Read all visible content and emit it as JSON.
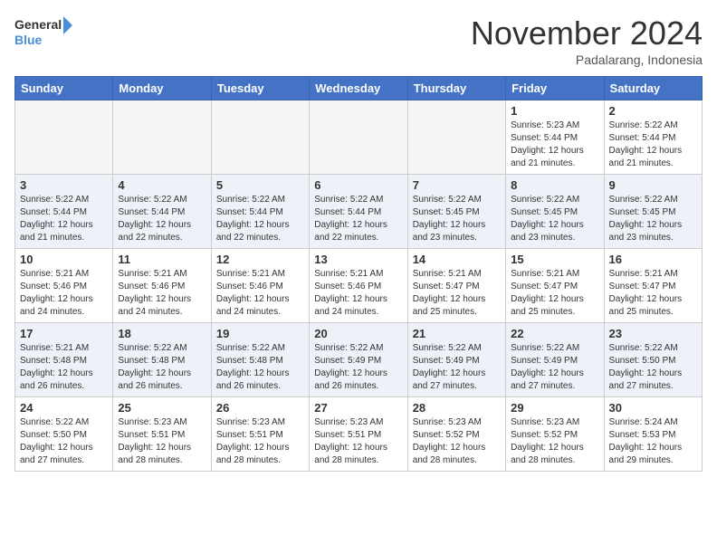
{
  "header": {
    "logo_line1": "General",
    "logo_line2": "Blue",
    "month": "November 2024",
    "location": "Padalarang, Indonesia"
  },
  "weekdays": [
    "Sunday",
    "Monday",
    "Tuesday",
    "Wednesday",
    "Thursday",
    "Friday",
    "Saturday"
  ],
  "weeks": [
    [
      {
        "day": "",
        "info": ""
      },
      {
        "day": "",
        "info": ""
      },
      {
        "day": "",
        "info": ""
      },
      {
        "day": "",
        "info": ""
      },
      {
        "day": "",
        "info": ""
      },
      {
        "day": "1",
        "info": "Sunrise: 5:23 AM\nSunset: 5:44 PM\nDaylight: 12 hours\nand 21 minutes."
      },
      {
        "day": "2",
        "info": "Sunrise: 5:22 AM\nSunset: 5:44 PM\nDaylight: 12 hours\nand 21 minutes."
      }
    ],
    [
      {
        "day": "3",
        "info": "Sunrise: 5:22 AM\nSunset: 5:44 PM\nDaylight: 12 hours\nand 21 minutes."
      },
      {
        "day": "4",
        "info": "Sunrise: 5:22 AM\nSunset: 5:44 PM\nDaylight: 12 hours\nand 22 minutes."
      },
      {
        "day": "5",
        "info": "Sunrise: 5:22 AM\nSunset: 5:44 PM\nDaylight: 12 hours\nand 22 minutes."
      },
      {
        "day": "6",
        "info": "Sunrise: 5:22 AM\nSunset: 5:44 PM\nDaylight: 12 hours\nand 22 minutes."
      },
      {
        "day": "7",
        "info": "Sunrise: 5:22 AM\nSunset: 5:45 PM\nDaylight: 12 hours\nand 23 minutes."
      },
      {
        "day": "8",
        "info": "Sunrise: 5:22 AM\nSunset: 5:45 PM\nDaylight: 12 hours\nand 23 minutes."
      },
      {
        "day": "9",
        "info": "Sunrise: 5:22 AM\nSunset: 5:45 PM\nDaylight: 12 hours\nand 23 minutes."
      }
    ],
    [
      {
        "day": "10",
        "info": "Sunrise: 5:21 AM\nSunset: 5:46 PM\nDaylight: 12 hours\nand 24 minutes."
      },
      {
        "day": "11",
        "info": "Sunrise: 5:21 AM\nSunset: 5:46 PM\nDaylight: 12 hours\nand 24 minutes."
      },
      {
        "day": "12",
        "info": "Sunrise: 5:21 AM\nSunset: 5:46 PM\nDaylight: 12 hours\nand 24 minutes."
      },
      {
        "day": "13",
        "info": "Sunrise: 5:21 AM\nSunset: 5:46 PM\nDaylight: 12 hours\nand 24 minutes."
      },
      {
        "day": "14",
        "info": "Sunrise: 5:21 AM\nSunset: 5:47 PM\nDaylight: 12 hours\nand 25 minutes."
      },
      {
        "day": "15",
        "info": "Sunrise: 5:21 AM\nSunset: 5:47 PM\nDaylight: 12 hours\nand 25 minutes."
      },
      {
        "day": "16",
        "info": "Sunrise: 5:21 AM\nSunset: 5:47 PM\nDaylight: 12 hours\nand 25 minutes."
      }
    ],
    [
      {
        "day": "17",
        "info": "Sunrise: 5:21 AM\nSunset: 5:48 PM\nDaylight: 12 hours\nand 26 minutes."
      },
      {
        "day": "18",
        "info": "Sunrise: 5:22 AM\nSunset: 5:48 PM\nDaylight: 12 hours\nand 26 minutes."
      },
      {
        "day": "19",
        "info": "Sunrise: 5:22 AM\nSunset: 5:48 PM\nDaylight: 12 hours\nand 26 minutes."
      },
      {
        "day": "20",
        "info": "Sunrise: 5:22 AM\nSunset: 5:49 PM\nDaylight: 12 hours\nand 26 minutes."
      },
      {
        "day": "21",
        "info": "Sunrise: 5:22 AM\nSunset: 5:49 PM\nDaylight: 12 hours\nand 27 minutes."
      },
      {
        "day": "22",
        "info": "Sunrise: 5:22 AM\nSunset: 5:49 PM\nDaylight: 12 hours\nand 27 minutes."
      },
      {
        "day": "23",
        "info": "Sunrise: 5:22 AM\nSunset: 5:50 PM\nDaylight: 12 hours\nand 27 minutes."
      }
    ],
    [
      {
        "day": "24",
        "info": "Sunrise: 5:22 AM\nSunset: 5:50 PM\nDaylight: 12 hours\nand 27 minutes."
      },
      {
        "day": "25",
        "info": "Sunrise: 5:23 AM\nSunset: 5:51 PM\nDaylight: 12 hours\nand 28 minutes."
      },
      {
        "day": "26",
        "info": "Sunrise: 5:23 AM\nSunset: 5:51 PM\nDaylight: 12 hours\nand 28 minutes."
      },
      {
        "day": "27",
        "info": "Sunrise: 5:23 AM\nSunset: 5:51 PM\nDaylight: 12 hours\nand 28 minutes."
      },
      {
        "day": "28",
        "info": "Sunrise: 5:23 AM\nSunset: 5:52 PM\nDaylight: 12 hours\nand 28 minutes."
      },
      {
        "day": "29",
        "info": "Sunrise: 5:23 AM\nSunset: 5:52 PM\nDaylight: 12 hours\nand 28 minutes."
      },
      {
        "day": "30",
        "info": "Sunrise: 5:24 AM\nSunset: 5:53 PM\nDaylight: 12 hours\nand 29 minutes."
      }
    ]
  ]
}
